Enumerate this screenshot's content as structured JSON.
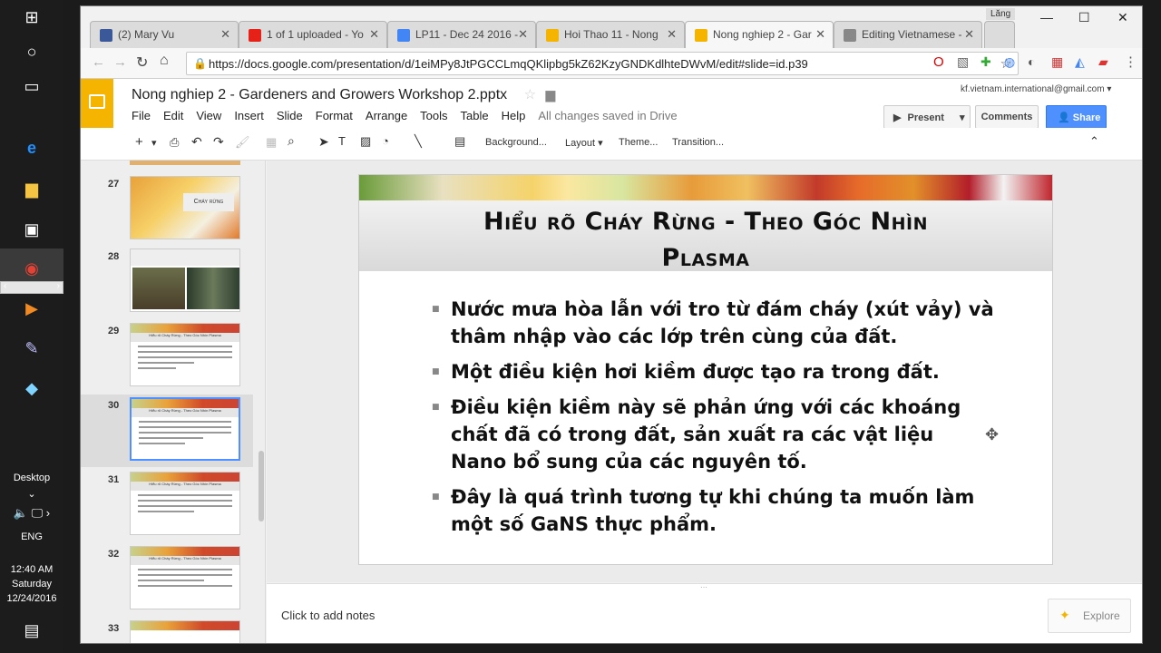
{
  "taskbar": {
    "desktop_label": "Desktop",
    "lang": "ENG",
    "time": "12:40 AM",
    "day": "Saturday",
    "date": "12/24/2016"
  },
  "browser": {
    "tabs": [
      {
        "label": "(2) Mary Vu",
        "color": "#3b5998"
      },
      {
        "label": "1 of 1 uploaded - Yo",
        "color": "#e62117"
      },
      {
        "label": "LP11 - Dec 24 2016 -",
        "color": "#4285f4"
      },
      {
        "label": "Hoi Thao 11 - Nong",
        "color": "#f4b400"
      },
      {
        "label": "Nong nghiep 2 - Gar",
        "color": "#f4b400"
      },
      {
        "label": "Editing Vietnamese -",
        "color": "#888888"
      }
    ],
    "user_badge": "Lăng",
    "url": "https://docs.google.com/presentation/d/1eiMPy8JtPGCCLmqQKlipbg5kZ62KzyGNDKdlhteDWvM/edit#slide=id.p39"
  },
  "docs": {
    "title": "Nong nghiep 2 - Gardeners and Growers Workshop 2.pptx",
    "menu": [
      "File",
      "Edit",
      "View",
      "Insert",
      "Slide",
      "Format",
      "Arrange",
      "Tools",
      "Table",
      "Help"
    ],
    "saved_status": "All changes saved in Drive",
    "account": "kf.vietnam.international@gmail.com",
    "present_label": "Present",
    "comments_label": "Comments",
    "share_label": "Share",
    "toolbar": {
      "background": "Background...",
      "layout": "Layout",
      "theme": "Theme...",
      "transition": "Transition..."
    }
  },
  "filmstrip": {
    "slides": [
      {
        "num": "27",
        "label": "Cháy rừng"
      },
      {
        "num": "28",
        "label": ""
      },
      {
        "num": "29",
        "label": "Hiểu rõ Cháy Rừng - Theo Góc Nhìn Plasma"
      },
      {
        "num": "30",
        "label": "Hiểu rõ Cháy Rừng - Theo Góc Nhìn Plasma"
      },
      {
        "num": "31",
        "label": "Hiểu rõ Cháy Rừng - Theo Góc Nhìn Plasma"
      },
      {
        "num": "32",
        "label": "Hiểu rõ Cháy Rừng - Theo Góc Nhìn Plasma"
      },
      {
        "num": "33",
        "label": ""
      }
    ],
    "selected": "30"
  },
  "slide": {
    "title_line1": "Hiểu rõ Cháy Rừng - Theo Góc Nhìn",
    "title_line2": "Plasma",
    "bullets": [
      "Nước mưa hòa lẫn với tro từ đám cháy (xút vảy) và thâm nhập vào các lớp trên cùng của đất.",
      "Một điều kiện hơi kiềm được tạo ra trong đất.",
      "Điều kiện kiềm này sẽ phản ứng với các khoáng chất đã có trong đất, sản xuất ra các vật liệu Nano bổ sung của các nguyên tố.",
      "Đây là quá trình tương tự khi chúng ta muốn làm một số GaNS thực phẩm."
    ]
  },
  "notes": {
    "placeholder": "Click to add notes",
    "explore_label": "Explore"
  }
}
